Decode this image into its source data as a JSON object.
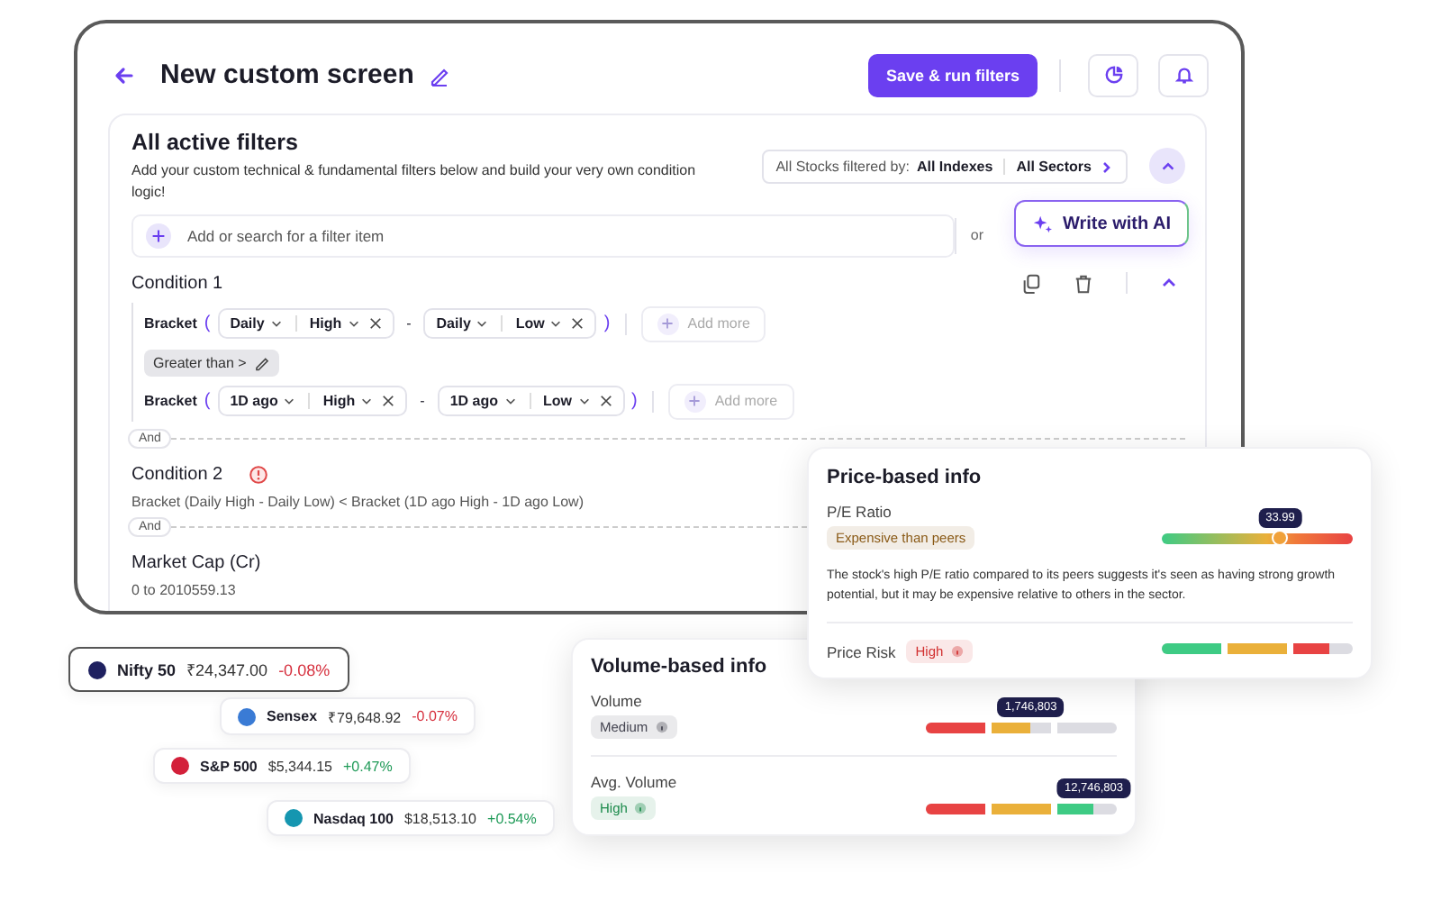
{
  "header": {
    "title": "New custom screen",
    "save_button": "Save & run filters"
  },
  "filters": {
    "title": "All active filters",
    "description": "Add your custom technical & fundamental filters below and build your very own condition logic!",
    "scope": {
      "label": "All Stocks filtered by:",
      "indexes": "All Indexes",
      "sectors": "All Sectors"
    }
  },
  "search": {
    "placeholder": "Add or search for a filter item",
    "or": "or",
    "ai_button": "Write with AI"
  },
  "conditions": [
    {
      "kind": "builder",
      "title": "Condition 1",
      "rows": [
        {
          "kind": "bracket",
          "label": "Bracket",
          "open": "(",
          "close": ")",
          "operator": "-",
          "add": "Add more",
          "terms": [
            [
              "Daily",
              "High"
            ],
            [
              "Daily",
              "Low"
            ]
          ]
        },
        {
          "kind": "comparator",
          "label": "Greater than >"
        },
        {
          "kind": "bracket",
          "label": "Bracket",
          "open": "(",
          "close": ")",
          "operator": "-",
          "add": "Add more",
          "terms": [
            [
              "1D ago",
              "High"
            ],
            [
              "1D ago",
              "Low"
            ]
          ]
        }
      ]
    },
    {
      "kind": "summary",
      "connector": "And",
      "title": "Condition 2",
      "warning": true,
      "text": "Bracket (Daily High - Daily Low) < Bracket (1D ago High - 1D ago Low)"
    },
    {
      "kind": "summary",
      "connector": "And",
      "title": "Market Cap (Cr)",
      "warning": false,
      "text": "0 to 2010559.13"
    }
  ],
  "price_card": {
    "title": "Price-based info",
    "metrics": [
      {
        "name": "P/E Ratio",
        "tag": "Expensive than peers",
        "color": "#8a5a17",
        "kind": "gradient",
        "level": 0.62,
        "reading": "33.99",
        "description": "The stock's high P/E ratio compared to its peers suggests it's seen as having strong growth potential, but it may be expensive relative to others in the sector."
      },
      {
        "name": "Price Risk",
        "tag": "High",
        "color": "#d23030",
        "kind": "risk",
        "level": 0.88
      }
    ]
  },
  "volume_card": {
    "title": "Volume-based info",
    "metrics": [
      {
        "name": "Volume",
        "tag": "Medium",
        "color": "#444450",
        "kind": "volume",
        "level": 0.55,
        "reading": "1,746,803"
      },
      {
        "name": "Avg. Volume",
        "tag": "High",
        "color": "#1d8b4c",
        "kind": "volume",
        "level": 0.88,
        "reading": "12,746,803"
      }
    ]
  },
  "tickers": [
    {
      "name": "Nifty 50",
      "price": "₹24,347.00",
      "change": "-0.08%",
      "negative": true,
      "color": "#1f2160",
      "selected": true
    },
    {
      "name": "Sensex",
      "price": "₹79,648.92",
      "change": "-0.07%",
      "negative": true,
      "color": "#3a7bd5",
      "selected": false
    },
    {
      "name": "S&P 500",
      "price": "$5,344.15",
      "change": "+0.47%",
      "negative": false,
      "color": "#d3203a",
      "selected": false
    },
    {
      "name": "Nasdaq 100",
      "price": "$18,513.10",
      "change": "+0.54%",
      "negative": false,
      "color": "#1596b0",
      "selected": false
    }
  ]
}
